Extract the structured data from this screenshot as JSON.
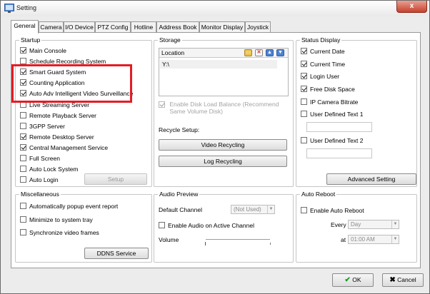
{
  "window": {
    "title": "Setting",
    "close_glyph": "x"
  },
  "tabs": [
    {
      "label": "General",
      "active": true
    },
    {
      "label": "Camera"
    },
    {
      "label": "I/O Device"
    },
    {
      "label": "PTZ Config"
    },
    {
      "label": "Hotline"
    },
    {
      "label": "Address Book"
    },
    {
      "label": "Monitor Display"
    },
    {
      "label": "Joystick"
    }
  ],
  "startup": {
    "title": "Startup",
    "items": [
      {
        "label": "Main Console",
        "checked": true
      },
      {
        "label": "Schedule Recording System",
        "checked": false
      },
      {
        "label": "Smart Guard System",
        "checked": true
      },
      {
        "label": "Counting Application",
        "checked": true
      },
      {
        "label": "Auto Adv Intelligent Video Surveillance",
        "checked": true
      },
      {
        "label": "Live Streaming Server",
        "checked": false
      },
      {
        "label": "Remote Playback Server",
        "checked": false
      },
      {
        "label": "3GPP Server",
        "checked": false
      },
      {
        "label": "Remote Desktop Server",
        "checked": true
      },
      {
        "label": "Central Management Service",
        "checked": true
      },
      {
        "label": "Full Screen",
        "checked": false
      },
      {
        "label": "Auto Lock System",
        "checked": false
      },
      {
        "label": "Auto Login",
        "checked": false
      }
    ],
    "setup_button": "Setup"
  },
  "storage": {
    "title": "Storage",
    "list_header": "Location",
    "list_items": [
      "Y:\\"
    ],
    "balance_label": "Enable Disk Load Balance (Recommend Same Volume Disk)",
    "balance_checked": true,
    "recycle_label": "Recycle Setup:",
    "video_recycling": "Video Recycling",
    "log_recycling": "Log Recycling"
  },
  "status_display": {
    "title": "Status Display",
    "items": [
      {
        "label": "Current Date",
        "checked": true
      },
      {
        "label": "Current Time",
        "checked": true
      },
      {
        "label": "Login User",
        "checked": true
      },
      {
        "label": "Free Disk Space",
        "checked": true
      },
      {
        "label": "IP Camera Bitrate",
        "checked": false
      },
      {
        "label": "User Defined Text 1",
        "checked": false
      },
      {
        "label": "User Defined Text 2",
        "checked": false
      }
    ],
    "advanced_button": "Advanced Setting"
  },
  "misc": {
    "title": "Miscellaneous",
    "items": [
      {
        "label": "Automatically popup event report",
        "checked": false
      },
      {
        "label": "Minimize to system tray",
        "checked": false
      },
      {
        "label": "Synchronize video frames",
        "checked": false
      }
    ],
    "ddns_button": "DDNS Service"
  },
  "audio": {
    "title": "Audio Preview",
    "default_channel_label": "Default Channel",
    "default_channel_value": "(Not Used)",
    "enable_label": "Enable Audio on Active Channel",
    "enable_checked": false,
    "volume_label": "Volume"
  },
  "reboot": {
    "title": "Auto Reboot",
    "enable_label": "Enable Auto Reboot",
    "enable_checked": false,
    "every_label": "Every",
    "every_value": "Day",
    "at_label": "at",
    "at_value": "01:00 AM"
  },
  "footer": {
    "ok": "OK",
    "cancel": "Cancel"
  },
  "colors": {
    "highlight": "#e41c24",
    "close": "#c7402c"
  }
}
